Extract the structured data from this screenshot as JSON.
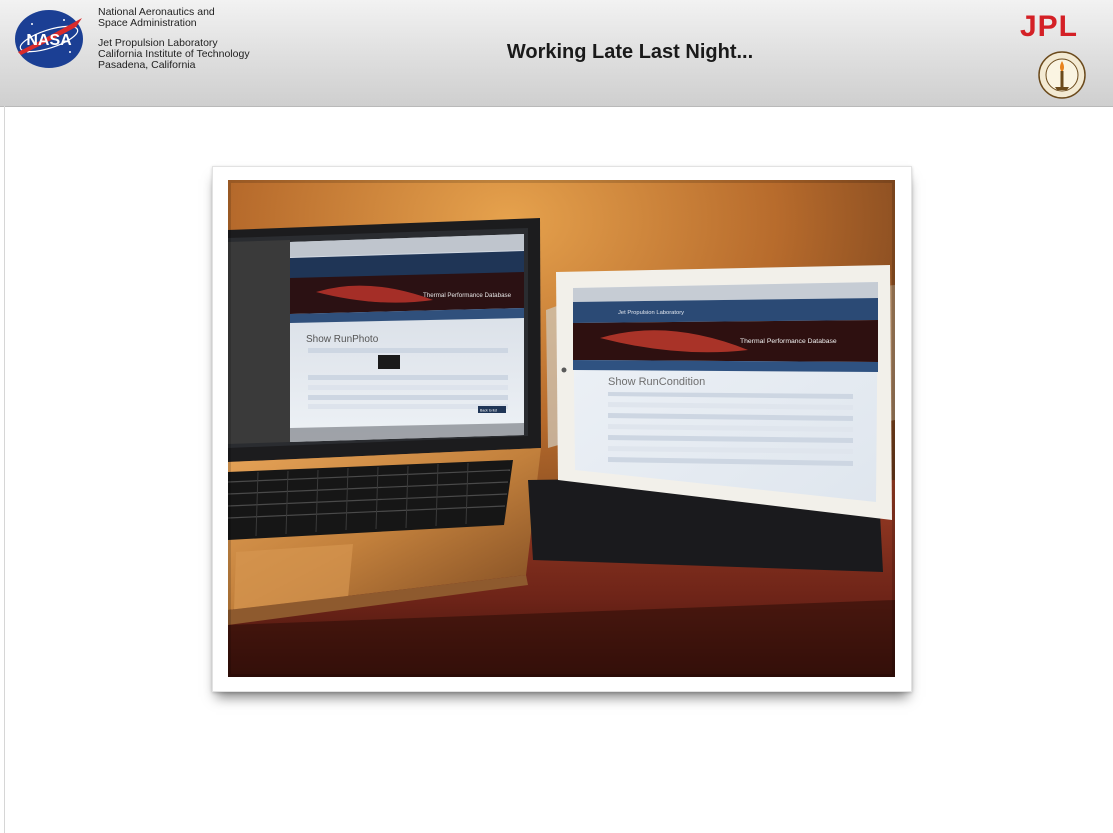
{
  "header": {
    "org_line1": "National Aeronautics and",
    "org_line2": "Space Administration",
    "lab_line1": "Jet Propulsion Laboratory",
    "lab_line2": "California Institute of Technology",
    "lab_line3": "Pasadena, California",
    "title": "Working Late Last Night...",
    "nasa_logo_text": "NASA",
    "jpl_logo_text": "JPL"
  },
  "photo": {
    "laptop_screen": {
      "banner_text": "Thermal Performance Database",
      "page_heading": "Show RunPhoto",
      "button_label": "Back to list"
    },
    "tablet_screen": {
      "lab_name": "Jet Propulsion Laboratory",
      "banner_text": "Thermal Performance Database",
      "page_heading": "Show RunCondition"
    }
  },
  "colors": {
    "header_gradient_top": "#f2f2f2",
    "header_gradient_bottom": "#cfcfcf",
    "nasa_blue": "#1b3f94",
    "nasa_red": "#d92b2b",
    "jpl_red": "#d42026",
    "wall_warm": "#c98638",
    "desk_red": "#7a2d1e"
  }
}
